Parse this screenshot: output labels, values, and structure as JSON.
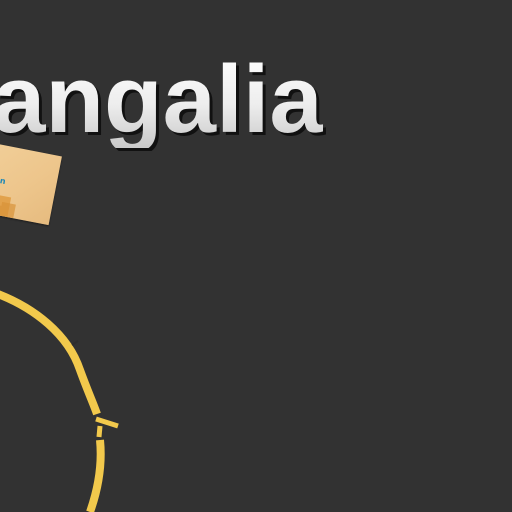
{
  "screen": {
    "background_color": "#323232"
  },
  "title": {
    "text": "angalia",
    "color": "#f2f2f2"
  },
  "card": {
    "text": "mon",
    "colors": {
      "paper": "#f0cb93",
      "steps": "#e2a24c",
      "text": "#1e88b6"
    }
  },
  "ring": {
    "color": "#f2c94c",
    "icon": "circle-track-icon"
  }
}
